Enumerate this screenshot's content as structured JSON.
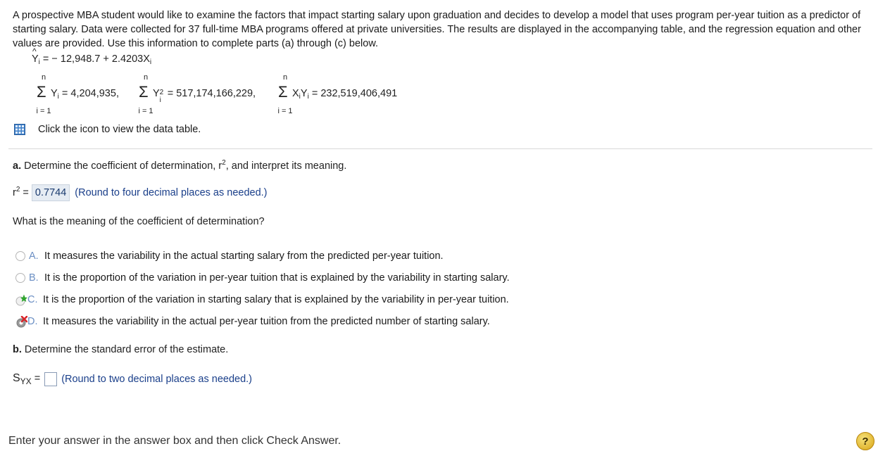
{
  "intro": "A prospective MBA student would like to examine the factors that impact starting salary upon graduation and decides to develop a model that uses program per-year tuition as a predictor of starting salary. Data were collected for 37 full-time MBA programs offered at private universities. The results are displayed in the accompanying table, and the regression equation and other values are provided. Use this information to complete parts (a) through (c) below.",
  "equation": {
    "lhs": "Y",
    "sub": "i",
    "rhs": " = − 12,948.7 + 2.4203X",
    "rhs_sub": "i"
  },
  "sums": [
    {
      "upper": "n",
      "lower": "i = 1",
      "expr": "Y",
      "sub": "i",
      "sup": "",
      "value": " = 4,204,935,"
    },
    {
      "upper": "n",
      "lower": "i = 1",
      "expr": "Y",
      "sub": "i",
      "sup": "2",
      "value": " = 517,174,166,229,"
    },
    {
      "upper": "n",
      "lower": "i = 1",
      "expr": "X",
      "sub": "i",
      "expr2": "Y",
      "sub2": "i",
      "value": " = 232,519,406,491"
    }
  ],
  "table_link": {
    "label": "Click the icon to view the data table.",
    "icon": "data-table-icon"
  },
  "part_a": {
    "label": "a.",
    "question": " Determine the coefficient of determination, r",
    "question_sup": "2",
    "question_tail": ", and interpret its meaning.",
    "r2_prefix": "r",
    "r2_sup": "2",
    "r2_eq": " =",
    "answer": "0.7744",
    "hint": "(Round to four decimal places as needed.)",
    "meaning_q": "What is the meaning of the coefficient of determination?",
    "options": [
      {
        "letter": "A.",
        "text": "It measures the variability in the actual starting salary from the predicted per-year tuition.",
        "state": "none"
      },
      {
        "letter": "B.",
        "text": "It is the proportion of the variation in per-year tuition that is explained by the variability in starting salary.",
        "state": "none"
      },
      {
        "letter": "C.",
        "text": "It is the proportion of the variation in starting salary that is explained by the variability in per-year tuition.",
        "state": "correct"
      },
      {
        "letter": "D.",
        "text": "It measures the variability in the actual per-year tuition from the predicted number of starting salary.",
        "state": "incorrect"
      }
    ]
  },
  "part_b": {
    "label": "b.",
    "question": " Determine the standard error of the estimate.",
    "syx_label": "S",
    "syx_sub": "YX",
    "syx_eq": " =",
    "answer": "",
    "hint": "(Round to two decimal places as needed.)"
  },
  "footer": "Enter your answer in the answer box and then click Check Answer.",
  "help_label": "?",
  "colors": {
    "accent": "#1a3f8a",
    "correct": "#2fa52f",
    "incorrect": "#d9262b",
    "answer_bg": "#e6ecf3"
  }
}
